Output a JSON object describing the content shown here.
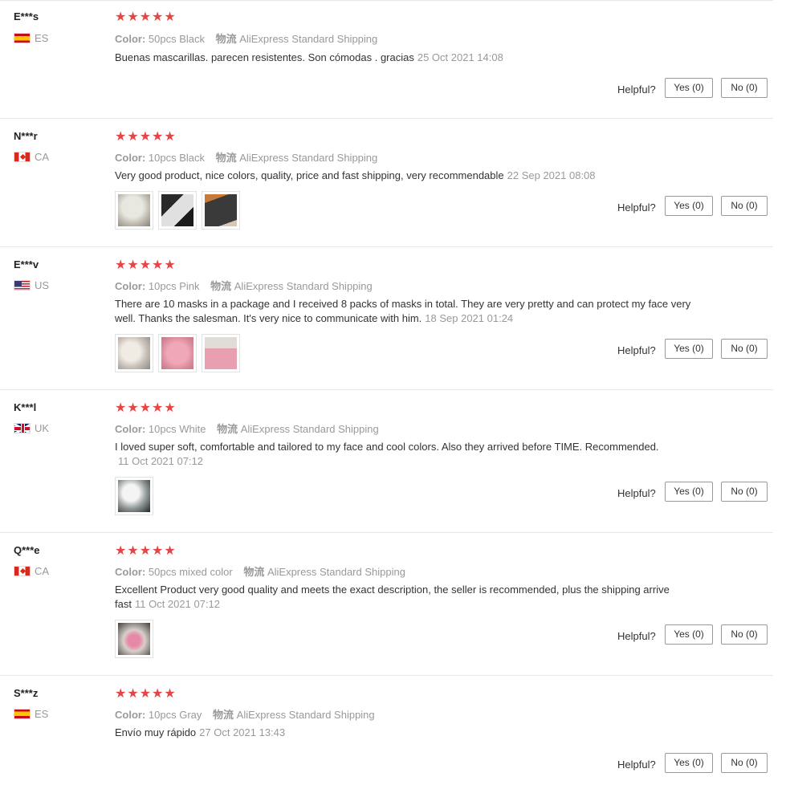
{
  "helpful_label": "Helpful?",
  "star_glyphs": "★★★★★",
  "colors": {
    "star": "#e64545",
    "muted": "#999999",
    "text": "#333333"
  },
  "reviews": [
    {
      "user": "E***s",
      "country": "ES",
      "flag": "es-flag-icon",
      "color_label": "Color:",
      "color_value": "50pcs Black",
      "shipping_label": "物流",
      "shipping_value": "AliExpress Standard Shipping",
      "text": "Buenas mascarillas. parecen resistentes. Son cómodas . gracias",
      "date": "25 Oct 2021 14:08",
      "rating": 5,
      "photos": [],
      "yes": "Yes (0)",
      "no": "No (0)"
    },
    {
      "user": "N***r",
      "country": "CA",
      "flag": "ca-flag-icon",
      "color_label": "Color:",
      "color_value": "10pcs Black",
      "shipping_label": "物流",
      "shipping_value": "AliExpress Standard Shipping",
      "text": "Very good product, nice colors, quality, price and fast shipping, very recommendable",
      "date": "22 Sep 2021 08:08",
      "rating": 5,
      "photos": [
        "photo-1",
        "photo-2",
        "photo-3"
      ],
      "yes": "Yes (0)",
      "no": "No (0)"
    },
    {
      "user": "E***v",
      "country": "US",
      "flag": "us-flag-icon",
      "color_label": "Color:",
      "color_value": "10pcs Pink",
      "shipping_label": "物流",
      "shipping_value": "AliExpress Standard Shipping",
      "text": "There are 10 masks in a package and I received 8 packs of masks in total. They are very pretty and can protect my face very well. Thanks the salesman. It's very nice to communicate with him.",
      "date": "18 Sep 2021 01:24",
      "rating": 5,
      "photos": [
        "photo-1",
        "photo-2",
        "photo-3"
      ],
      "yes": "Yes (0)",
      "no": "No (0)"
    },
    {
      "user": "K***l",
      "country": "UK",
      "flag": "uk-flag-icon",
      "color_label": "Color:",
      "color_value": "10pcs White",
      "shipping_label": "物流",
      "shipping_value": "AliExpress Standard Shipping",
      "text": "I loved super soft, comfortable and tailored to my face and cool colors. Also they arrived before TIME. Recommended.",
      "date": "11 Oct 2021 07:12",
      "rating": 5,
      "photos": [
        "photo-1"
      ],
      "yes": "Yes (0)",
      "no": "No (0)"
    },
    {
      "user": "Q***e",
      "country": "CA",
      "flag": "ca-flag-icon",
      "color_label": "Color:",
      "color_value": "50pcs mixed color",
      "shipping_label": "物流",
      "shipping_value": "AliExpress Standard Shipping",
      "text": "Excellent Product very good quality and meets the exact description, the seller is recommended, plus the shipping arrive fast",
      "date": "11 Oct 2021 07:12",
      "rating": 5,
      "photos": [
        "photo-1"
      ],
      "yes": "Yes (0)",
      "no": "No (0)"
    },
    {
      "user": "S***z",
      "country": "ES",
      "flag": "es-flag-icon",
      "color_label": "Color:",
      "color_value": "10pcs Gray",
      "shipping_label": "物流",
      "shipping_value": "AliExpress Standard Shipping",
      "text": "Envío muy rápido",
      "date": "27 Oct 2021 13:43",
      "rating": 5,
      "photos": [],
      "yes": "Yes (0)",
      "no": "No (0)"
    }
  ]
}
